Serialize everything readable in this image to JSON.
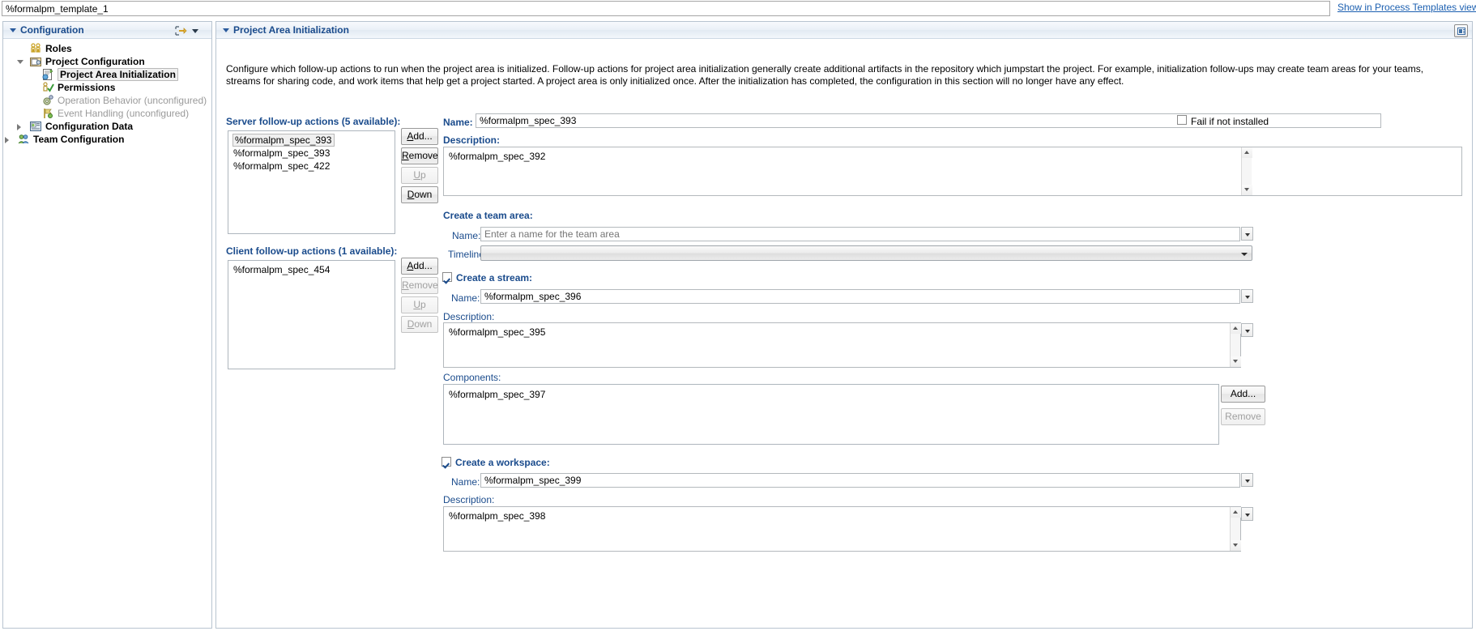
{
  "topbar": {
    "template_name": "%formalpm_template_1",
    "show_link": "Show in Process Templates view"
  },
  "left_panel": {
    "title": "Configuration",
    "tree": [
      {
        "label": "Roles",
        "icon": "roles-icon",
        "indent": 32,
        "state": "normal",
        "arrow": "none"
      },
      {
        "label": "Project Configuration",
        "icon": "project-configuration-icon",
        "indent": 32,
        "state": "normal",
        "arrow": "open"
      },
      {
        "label": "Project Area Initialization",
        "icon": "project-area-initialization-icon",
        "indent": 47,
        "state": "selected",
        "arrow": "none"
      },
      {
        "label": "Permissions",
        "icon": "permissions-icon",
        "indent": 47,
        "state": "normal",
        "arrow": "none"
      },
      {
        "label": "Operation Behavior (unconfigured)",
        "icon": "operation-behavior-icon",
        "indent": 47,
        "state": "dim",
        "arrow": "none"
      },
      {
        "label": "Event Handling (unconfigured)",
        "icon": "event-handling-icon",
        "indent": 47,
        "state": "dim",
        "arrow": "none"
      },
      {
        "label": "Configuration Data",
        "icon": "configuration-data-icon",
        "indent": 32,
        "state": "normal",
        "arrow": "closed"
      },
      {
        "label": "Team Configuration",
        "icon": "team-configuration-icon",
        "indent": 17,
        "state": "normal",
        "arrow": "closed"
      }
    ]
  },
  "right_panel": {
    "title": "Project Area Initialization",
    "description": "Configure which follow-up actions to run when the project area is initialized. Follow-up actions for project area initialization generally create additional artifacts in the repository which jumpstart the project. For example, initialization follow-ups may create team areas for your teams, streams for sharing code, and work items that help get a project started. A project area is only initialized once. After the initialization has completed, the configuration in this section will no longer have any effect.",
    "server_actions": {
      "label": "Server follow-up actions (5 available):",
      "items": [
        "%formalpm_spec_393",
        "%formalpm_spec_393",
        "%formalpm_spec_422"
      ],
      "selected_index": 0,
      "buttons": [
        {
          "label": "Add...",
          "mnemonic": "A",
          "enabled": true
        },
        {
          "label": "Remove",
          "mnemonic": "R",
          "enabled": true
        },
        {
          "label": "Up",
          "mnemonic": "U",
          "enabled": false
        },
        {
          "label": "Down",
          "mnemonic": "D",
          "enabled": true
        }
      ]
    },
    "client_actions": {
      "label": "Client follow-up actions (1 available):",
      "items": [
        "%formalpm_spec_454"
      ],
      "buttons": [
        {
          "label": "Add...",
          "mnemonic": "A",
          "enabled": true
        },
        {
          "label": "Remove",
          "mnemonic": "R",
          "enabled": false
        },
        {
          "label": "Up",
          "mnemonic": "U",
          "enabled": false
        },
        {
          "label": "Down",
          "mnemonic": "D",
          "enabled": false
        }
      ]
    },
    "detail": {
      "name_label": "Name:",
      "name_value": "%formalpm_spec_393",
      "description_label": "Description:",
      "description_value": "%formalpm_spec_392",
      "fail_checkbox_label": "Fail if not installed",
      "fail_checkbox_mnemonic": "l",
      "fail_checked": false
    },
    "team_area": {
      "heading": "Create a team area:",
      "name_label": "Name:",
      "name_placeholder": "Enter a name for the team area",
      "timeline_label": "Timeline:",
      "timeline_value": ""
    },
    "stream": {
      "heading": "Create a stream:",
      "checked": true,
      "name_label": "Name:",
      "name_value": "%formalpm_spec_396",
      "description_label": "Description:",
      "description_value": "%formalpm_spec_395",
      "components_label": "Components:",
      "components_items": [
        "%formalpm_spec_397"
      ],
      "components_buttons": [
        {
          "label": "Add...",
          "enabled": true
        },
        {
          "label": "Remove",
          "enabled": false
        }
      ]
    },
    "workspace": {
      "heading": "Create a workspace:",
      "checked": true,
      "name_label": "Name:",
      "name_value": "%formalpm_spec_399",
      "description_label": "Description:",
      "description_value": "%formalpm_spec_398"
    }
  },
  "colors": {
    "accent": "#1a4b8c",
    "link": "#1b5fb0",
    "panel_border": "#b8c4d0"
  }
}
